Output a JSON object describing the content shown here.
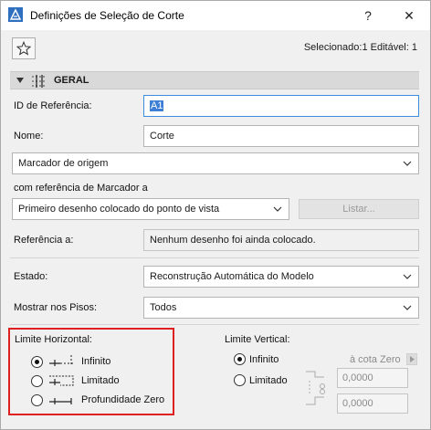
{
  "window": {
    "title": "Definições de Seleção de Corte",
    "help_label": "?",
    "close_label": "✕"
  },
  "toolbar": {
    "selection_info": "Selecionado:1 Editável: 1"
  },
  "section": {
    "title": "GERAL"
  },
  "fields": {
    "ref_id_label": "ID de Referência:",
    "ref_id_value": "A1",
    "name_label": "Nome:",
    "name_value": "Corte",
    "marker_dropdown": "Marcador de origem",
    "marker_ref_label": "com referência de Marcador a",
    "marker_ref_dropdown": "Primeiro desenho colocado do ponto de vista",
    "list_button": "Listar...",
    "reference_label": "Referência a:",
    "reference_value": "Nenhum desenho foi ainda colocado.",
    "state_label": "Estado:",
    "state_dropdown": "Reconstrução Automática do Modelo",
    "show_floors_label": "Mostrar nos Pisos:",
    "show_floors_dropdown": "Todos"
  },
  "horizontal_limit": {
    "title": "Limite Horizontal:",
    "options": [
      {
        "label": "Infinito",
        "selected": true
      },
      {
        "label": "Limitado",
        "selected": false
      },
      {
        "label": "Profundidade Zero",
        "selected": false
      }
    ]
  },
  "vertical_limit": {
    "title": "Limite Vertical:",
    "options": [
      {
        "label": "Infinito",
        "selected": true
      },
      {
        "label": "Limitado",
        "selected": false
      }
    ],
    "elevation_label": "à cota Zero",
    "value_top": "0,0000",
    "value_bottom": "0,0000"
  },
  "colors": {
    "highlight": "#e02020",
    "selection": "#3d7fd6",
    "field_focus": "#3c8ce0"
  }
}
